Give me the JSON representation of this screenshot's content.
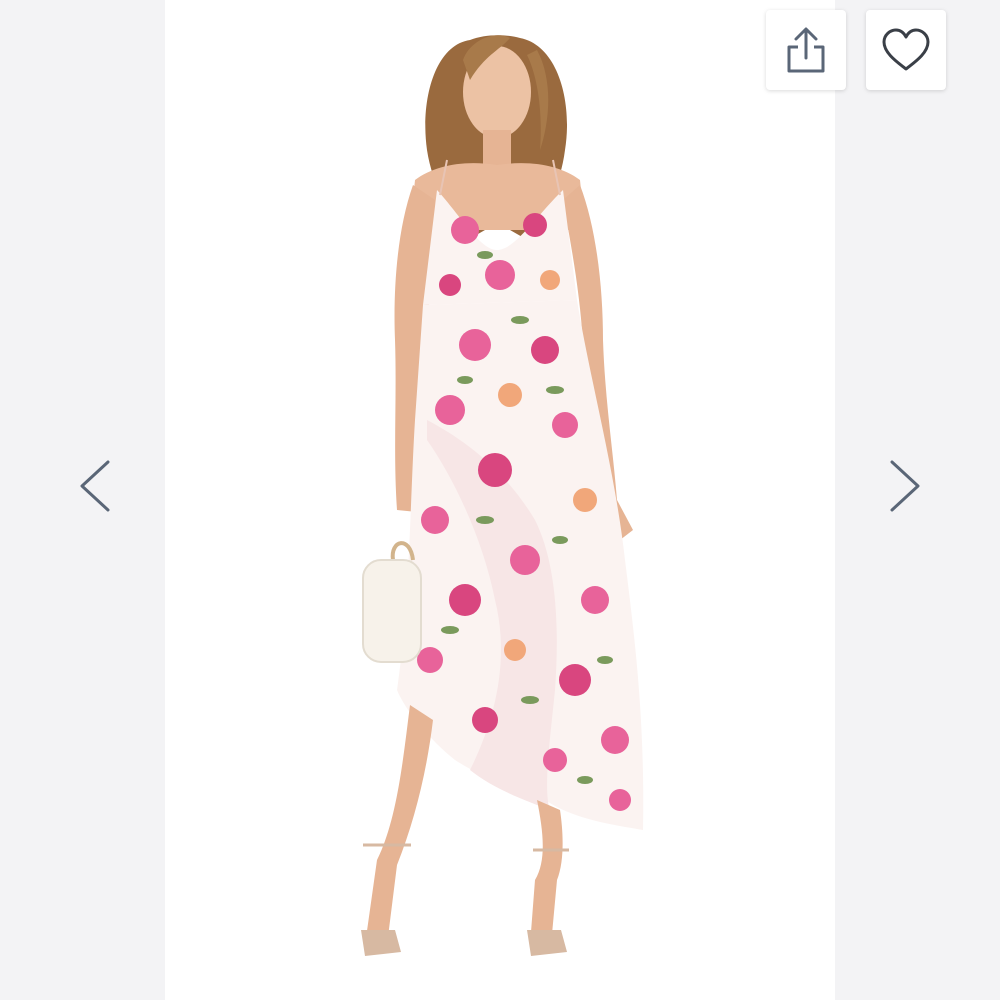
{
  "viewer": {
    "background": "#f3f3f5",
    "stage_background": "#ffffff"
  },
  "navigation": {
    "prev_icon": "chevron-left-icon",
    "next_icon": "chevron-right-icon"
  },
  "actions": {
    "share_icon": "share-icon",
    "favorite_icon": "heart-icon"
  },
  "product_image": {
    "subject": "model-wearing-floral-dress",
    "palette": {
      "dress_base": "#fbf3f1",
      "flower_pink": "#e8639a",
      "flower_rose": "#d9467f",
      "flower_peach": "#f1a77a",
      "leaf_green": "#7a9a5c",
      "skin": "#e9b99a",
      "hair": "#9a6a3e",
      "bag": "#f7f2ea",
      "heels": "#d7b9a2"
    }
  },
  "icon_color": "#5a6677"
}
